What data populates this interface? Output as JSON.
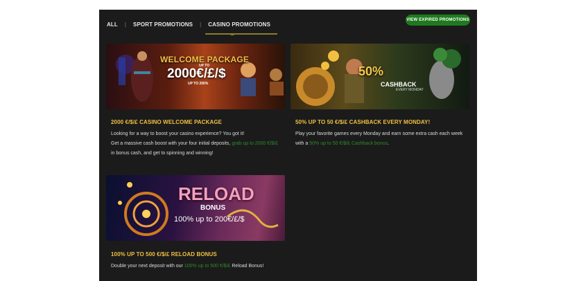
{
  "tabs": [
    {
      "label": "ALL"
    },
    {
      "label": "SPORT PROMOTIONS"
    },
    {
      "label": "CASINO PROMOTIONS"
    }
  ],
  "expired_button": "VIEW EXPIRED PROMOTIONS",
  "promos": [
    {
      "banner": {
        "line1": "WELCOME PACKAGE",
        "line2": "UP TO",
        "line3": "2000€/£/$",
        "line4": "UP TO 200%"
      },
      "title": "2000 €/$/£ CASINO WELCOME PACKAGE",
      "desc_a": "Looking for a way to boost your casino experience? You got it!",
      "desc_b": "Get a massive cash boost with your four initial deposits,",
      "desc_link": "grab up to 2000 €/$/£",
      "desc_c": "in bonus cash, and get to spinning and winning!"
    },
    {
      "banner": {
        "line1": "50%",
        "line2": "CASHBACK",
        "line3": "EVERY MONDAY"
      },
      "title": "50% UP TO 50 €/$/£ CASHBACK EVERY MONDAY!",
      "desc_a": "Play your favorite games every Monday and earn some extra cash each week",
      "desc_b": "with a",
      "desc_link": "50% up to 50 €/$/£ Cashback bonus",
      "desc_c": "."
    },
    {
      "banner": {
        "line1": "RELOAD",
        "line2": "BONUS",
        "line3": "100% up to 200€/£/$"
      },
      "title": "100% UP TO 500 €/$/£ RELOAD BONUS",
      "desc_a": "Double your next deposit with our",
      "desc_link": "100% up to 500 €/$/£",
      "desc_c": "Reload Bonus!"
    }
  ],
  "colors": {
    "accent": "#f0c040",
    "green": "#1f7a1f",
    "bg": "#1b1b1b"
  }
}
